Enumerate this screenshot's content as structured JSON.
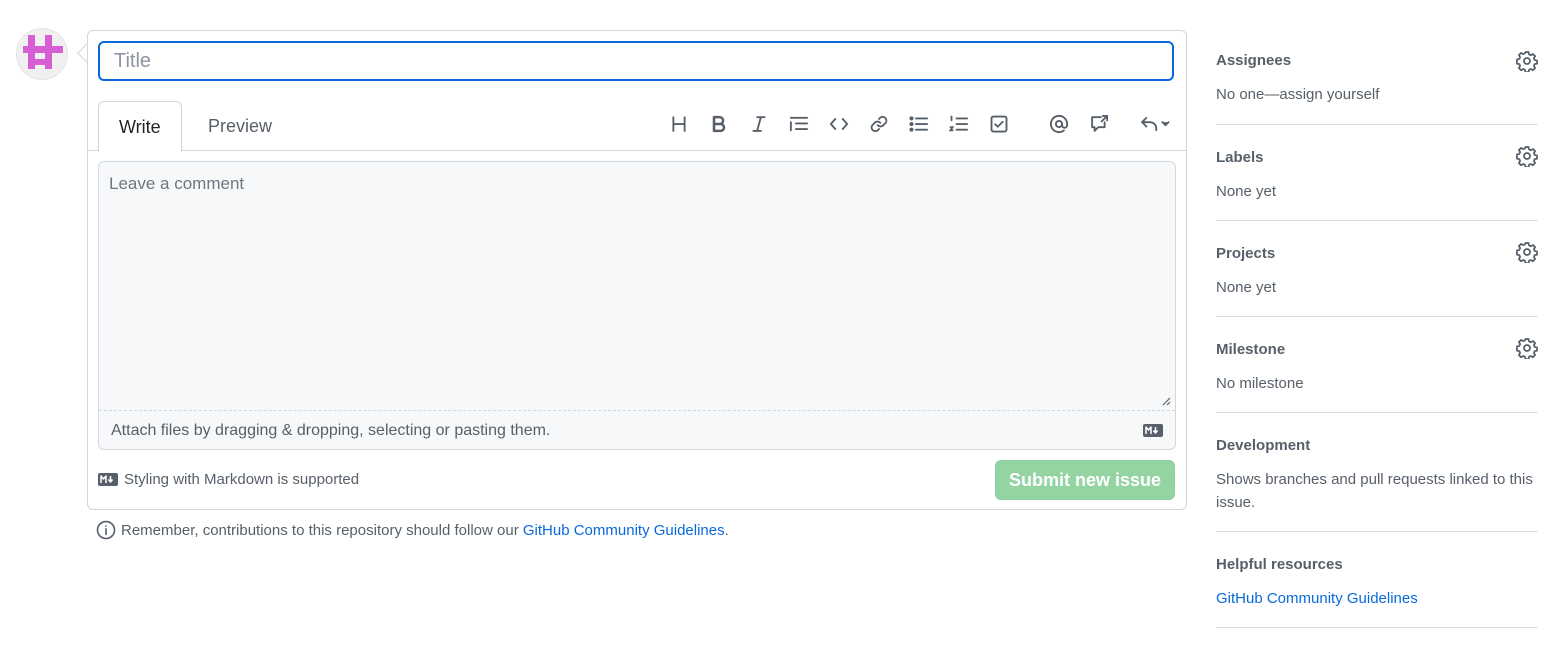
{
  "issue_form": {
    "title_placeholder": "Title",
    "tabs": {
      "write": "Write",
      "preview": "Preview"
    },
    "toolbar_icons": [
      "heading-icon",
      "bold-icon",
      "italic-icon",
      "quote-icon",
      "code-icon",
      "link-icon",
      "bulleted-list-icon",
      "numbered-list-icon",
      "task-list-icon",
      "mention-icon",
      "reference-icon",
      "saved-replies-icon"
    ],
    "comment_placeholder": "Leave a comment",
    "attach_hint": "Attach files by dragging & dropping, selecting or pasting them.",
    "markdown_support": "Styling with Markdown is supported",
    "submit_label": "Submit new issue",
    "submit_color": "#94d3a2"
  },
  "guideline_note": {
    "text": "Remember, contributions to this repository should follow our",
    "link": "GitHub Community Guidelines",
    "end": "."
  },
  "sidebar": {
    "assignees": {
      "heading": "Assignees",
      "value": "No one—assign yourself"
    },
    "labels": {
      "heading": "Labels",
      "value": "None yet"
    },
    "projects": {
      "heading": "Projects",
      "value": "None yet"
    },
    "milestone": {
      "heading": "Milestone",
      "value": "No milestone"
    },
    "development": {
      "heading": "Development",
      "value": "Shows branches and pull requests linked to this issue."
    },
    "helpful": {
      "heading": "Helpful resources",
      "link": "GitHub Community Guidelines"
    }
  },
  "colors": {
    "accent": "#0969da",
    "muted": "#57606a",
    "avatar": "#d65fd4"
  }
}
